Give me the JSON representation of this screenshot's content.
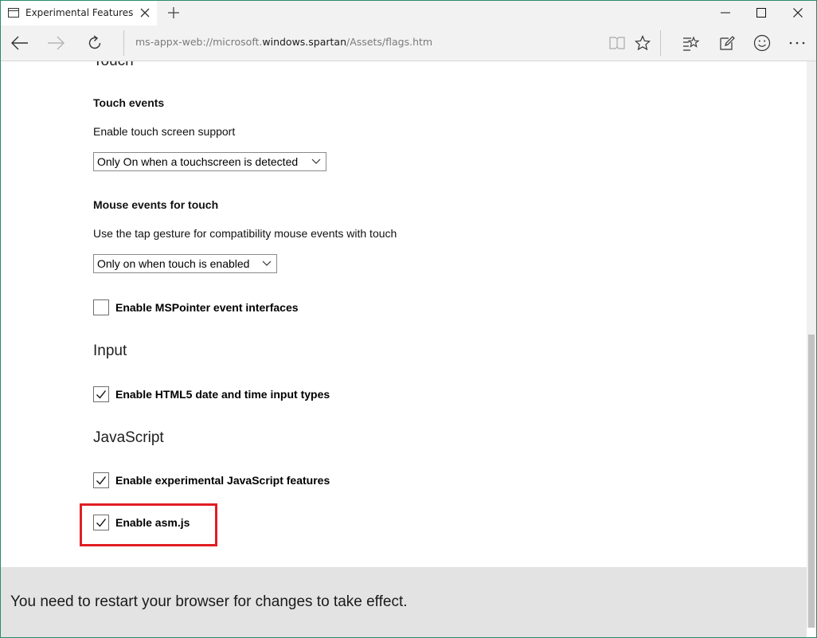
{
  "tab": {
    "title": "Experimental Features"
  },
  "toolbar": {
    "address_prefix": "ms-appx-web://microsoft.",
    "address_host": "windows.spartan",
    "address_suffix": "/Assets/flags.htm"
  },
  "page": {
    "partial_heading": "Touch",
    "touch_events": {
      "title": "Touch events",
      "description": "Enable touch screen support",
      "selected": "Only On when a touchscreen is detected"
    },
    "mouse_events": {
      "title": "Mouse events for touch",
      "description": "Use the tap gesture for compatibility mouse events with touch",
      "selected": "Only on when touch is enabled"
    },
    "mspointer": {
      "label": "Enable MSPointer event interfaces",
      "checked": false
    },
    "input_section": {
      "title": "Input"
    },
    "html5_date": {
      "label": "Enable HTML5 date and time input types",
      "checked": true
    },
    "js_section": {
      "title": "JavaScript"
    },
    "experimental_js": {
      "label": "Enable experimental JavaScript features",
      "checked": true
    },
    "asmjs": {
      "label": "Enable asm.js",
      "checked": true
    }
  },
  "restart_bar": {
    "message": "You need to restart your browser for changes to take effect."
  },
  "colors": {
    "accent_border": "#2b8a6e",
    "highlight": "#e01e24",
    "bar_bg": "#e3e3e3"
  }
}
